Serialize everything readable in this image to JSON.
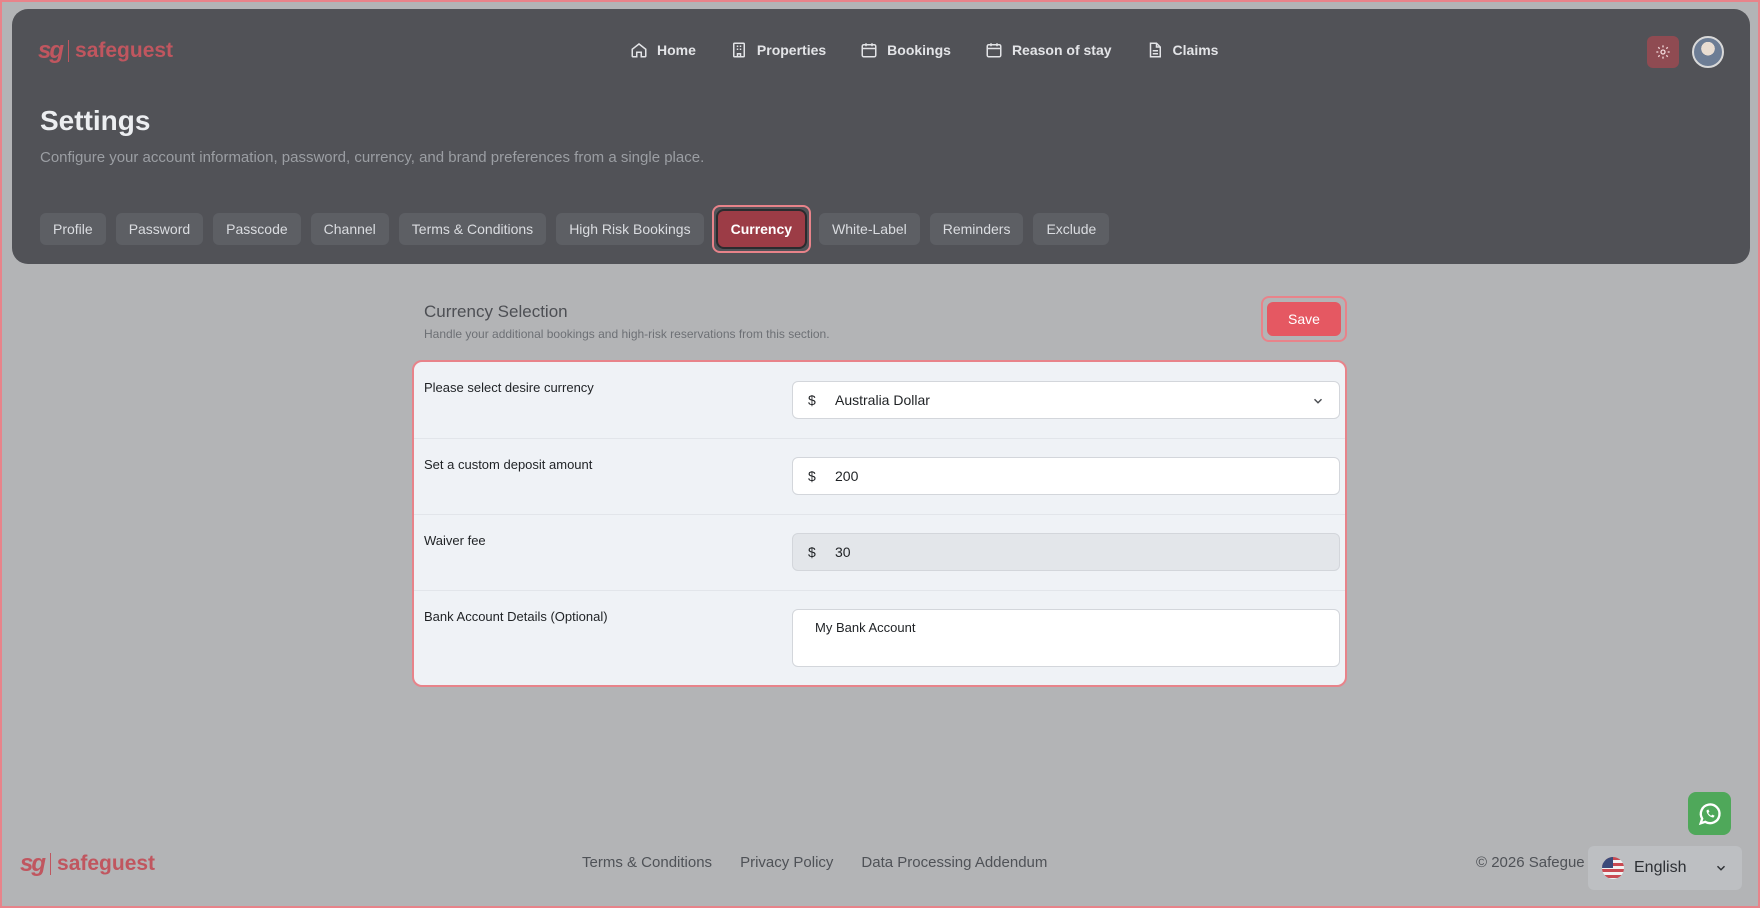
{
  "brand": {
    "name": "safeguest",
    "mark": "sg"
  },
  "nav": [
    {
      "label": "Home",
      "icon": "home-icon"
    },
    {
      "label": "Properties",
      "icon": "building-icon"
    },
    {
      "label": "Bookings",
      "icon": "calendar-icon"
    },
    {
      "label": "Reason of stay",
      "icon": "calendar-icon"
    },
    {
      "label": "Claims",
      "icon": "document-icon"
    }
  ],
  "page": {
    "title": "Settings",
    "subtitle": "Configure your account information, password, currency, and brand preferences from a single place."
  },
  "tabs": [
    {
      "label": "Profile"
    },
    {
      "label": "Password"
    },
    {
      "label": "Passcode"
    },
    {
      "label": "Channel"
    },
    {
      "label": "Terms & Conditions"
    },
    {
      "label": "High Risk Bookings"
    },
    {
      "label": "Currency",
      "active": true
    },
    {
      "label": "White-Label"
    },
    {
      "label": "Reminders"
    },
    {
      "label": "Exclude"
    }
  ],
  "section": {
    "title": "Currency Selection",
    "subtitle": "Handle your additional bookings and high-risk reservations from this section.",
    "save_label": "Save"
  },
  "form": {
    "currency": {
      "label": "Please select desire currency",
      "symbol": "$",
      "value": "Australia Dollar"
    },
    "deposit": {
      "label": "Set a custom deposit amount",
      "symbol": "$",
      "value": "200"
    },
    "waiver": {
      "label": "Waiver fee",
      "symbol": "$",
      "value": "30"
    },
    "bank": {
      "label": "Bank Account Details (Optional)",
      "value": "My Bank Account"
    }
  },
  "footer": {
    "links": [
      "Terms & Conditions",
      "Privacy Policy",
      "Data Processing Addendum"
    ],
    "copyright": "© 2026 Safegue"
  },
  "language": {
    "selected": "English"
  },
  "colors": {
    "accent": "#e55862",
    "active_tab": "#9c3c46",
    "header_bg": "#515257",
    "highlight": "#e8838a"
  }
}
